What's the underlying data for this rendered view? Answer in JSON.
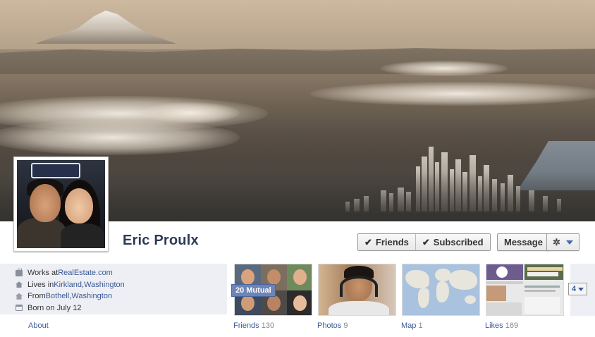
{
  "profile": {
    "name": "Eric Proulx"
  },
  "actions": {
    "friends_label": "Friends",
    "subscribed_label": "Subscribed",
    "message_label": "Message",
    "check_glyph": "✔",
    "gear_glyph": "✲"
  },
  "info": {
    "work_prefix": "Works at ",
    "work_link": "RealEstate.com",
    "lives_prefix": "Lives in ",
    "lives_city": "Kirkland",
    "lives_sep": ", ",
    "lives_state": "Washington",
    "from_prefix": "From ",
    "from_city": "Bothell",
    "from_sep": ", ",
    "from_state": "Washington",
    "born": "Born on July 12"
  },
  "about_label": "About",
  "tiles": {
    "friends": {
      "label": "Friends",
      "count": "130",
      "badge": "20 Mutual"
    },
    "photos": {
      "label": "Photos",
      "count": "9"
    },
    "map": {
      "label": "Map",
      "count": "1"
    },
    "likes": {
      "label": "Likes",
      "count": "169"
    }
  },
  "more": {
    "count": "4"
  },
  "colors": {
    "link": "#3b5998",
    "name": "#2d3a57",
    "info_bg": "#edeff4",
    "badge_bg": "#6d84b4"
  }
}
